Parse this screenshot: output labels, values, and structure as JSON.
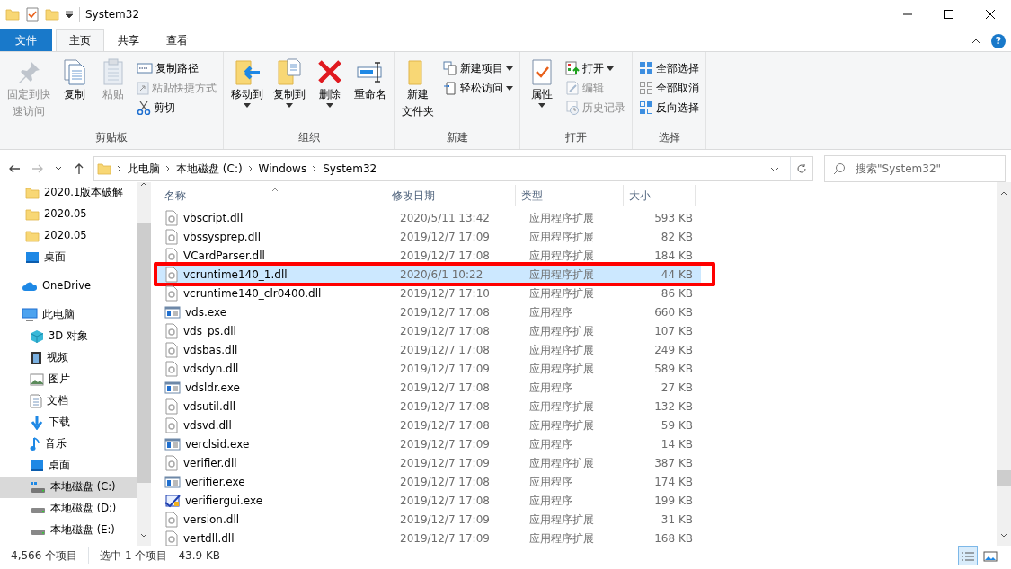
{
  "window": {
    "title": "System32"
  },
  "tabs": [
    {
      "label": "文件",
      "kind": "file",
      "selected": false
    },
    {
      "label": "主页",
      "kind": "tab",
      "selected": true
    },
    {
      "label": "共享",
      "kind": "tab",
      "selected": false
    },
    {
      "label": "查看",
      "kind": "tab",
      "selected": false
    }
  ],
  "help": "?",
  "ribbon": {
    "groups": [
      {
        "label": "剪贴板",
        "items": [
          {
            "label": [
              "固定到快",
              "速访问"
            ],
            "kind": "large",
            "disabled": true,
            "dropdown": false
          },
          {
            "label": [
              "复制"
            ],
            "kind": "large",
            "disabled": false,
            "dropdown": false
          },
          {
            "label": [
              "粘贴"
            ],
            "kind": "large",
            "disabled": true,
            "dropdown": false
          },
          {
            "label": "复制路径",
            "kind": "small",
            "disabled": false,
            "dropdown": false
          },
          {
            "label": "粘贴快捷方式",
            "kind": "small",
            "disabled": true,
            "dropdown": false
          },
          {
            "label": "剪切",
            "kind": "small",
            "disabled": false,
            "dropdown": false
          }
        ]
      },
      {
        "label": "组织",
        "items": [
          {
            "label": [
              "移动到"
            ],
            "kind": "large",
            "disabled": false,
            "dropdown": true
          },
          {
            "label": [
              "复制到"
            ],
            "kind": "large",
            "disabled": false,
            "dropdown": true
          },
          {
            "label": [
              "删除"
            ],
            "kind": "large",
            "disabled": false,
            "dropdown": true
          },
          {
            "label": [
              "重命名"
            ],
            "kind": "large",
            "disabled": false,
            "dropdown": false
          }
        ]
      },
      {
        "label": "新建",
        "items": [
          {
            "label": [
              "新建",
              "文件夹"
            ],
            "kind": "large",
            "disabled": false,
            "dropdown": false
          },
          {
            "label": "新建项目",
            "kind": "small",
            "disabled": false,
            "dropdown": true
          },
          {
            "label": "轻松访问",
            "kind": "small",
            "disabled": false,
            "dropdown": true
          }
        ]
      },
      {
        "label": "打开",
        "items": [
          {
            "label": [
              "属性"
            ],
            "kind": "large",
            "disabled": false,
            "dropdown": true
          },
          {
            "label": "打开",
            "kind": "small",
            "disabled": false,
            "dropdown": true
          },
          {
            "label": "编辑",
            "kind": "small",
            "disabled": true,
            "dropdown": false
          },
          {
            "label": "历史记录",
            "kind": "small",
            "disabled": true,
            "dropdown": false
          }
        ]
      },
      {
        "label": "选择",
        "items": [
          {
            "label": "全部选择",
            "kind": "small",
            "disabled": false,
            "dropdown": false
          },
          {
            "label": "全部取消",
            "kind": "small",
            "disabled": false,
            "dropdown": false
          },
          {
            "label": "反向选择",
            "kind": "small",
            "disabled": false,
            "dropdown": false
          }
        ]
      }
    ]
  },
  "address": {
    "nav_buttons": [
      {
        "disabled": false
      },
      {
        "disabled": true
      },
      {
        "disabled": false
      },
      {
        "disabled": false
      }
    ],
    "path": [
      "此电脑",
      "本地磁盘 (C:)",
      "Windows",
      "System32"
    ],
    "search": {
      "placeholder": "搜索\"System32\""
    }
  },
  "sidebar": {
    "quick_access_items": [
      {
        "label": "2020.1版本破解",
        "selected": false
      },
      {
        "label": "2020.05",
        "selected": false
      },
      {
        "label": "2020.05",
        "selected": false
      },
      {
        "label": "桌面",
        "selected": false
      }
    ],
    "items": [
      {
        "label": "OneDrive",
        "selected": false
      },
      {
        "label": "此电脑",
        "selected": false,
        "children": [
          {
            "label": "3D 对象",
            "selected": false
          },
          {
            "label": "视频",
            "selected": false
          },
          {
            "label": "图片",
            "selected": false
          },
          {
            "label": "文档",
            "selected": false
          },
          {
            "label": "下载",
            "selected": false
          },
          {
            "label": "音乐",
            "selected": false
          },
          {
            "label": "桌面",
            "selected": false
          },
          {
            "label": "本地磁盘 (C:)",
            "selected": true
          },
          {
            "label": "本地磁盘 (D:)",
            "selected": false
          },
          {
            "label": "本地磁盘 (E:)",
            "selected": false
          }
        ]
      }
    ]
  },
  "table": {
    "columns": [
      "名称",
      "修改日期",
      "类型",
      "大小"
    ],
    "rows": [
      {
        "name": "vbscript.dll",
        "date": "2020/5/11 13:42",
        "type": "应用程序扩展",
        "size": "593 KB",
        "selected": false,
        "outlined": false
      },
      {
        "name": "vbssysprep.dll",
        "date": "2019/12/7 17:09",
        "type": "应用程序扩展",
        "size": "82 KB",
        "selected": false,
        "outlined": false
      },
      {
        "name": "VCardParser.dll",
        "date": "2019/12/7 17:08",
        "type": "应用程序扩展",
        "size": "184 KB",
        "selected": false,
        "outlined": false
      },
      {
        "name": "vcruntime140_1.dll",
        "date": "2020/6/1 10:22",
        "type": "应用程序扩展",
        "size": "44 KB",
        "selected": true,
        "outlined": true
      },
      {
        "name": "vcruntime140_clr0400.dll",
        "date": "2019/12/7 17:10",
        "type": "应用程序扩展",
        "size": "86 KB",
        "selected": false,
        "outlined": false
      },
      {
        "name": "vds.exe",
        "date": "2019/12/7 17:08",
        "type": "应用程序",
        "size": "660 KB",
        "selected": false,
        "outlined": false
      },
      {
        "name": "vds_ps.dll",
        "date": "2019/12/7 17:08",
        "type": "应用程序扩展",
        "size": "107 KB",
        "selected": false,
        "outlined": false
      },
      {
        "name": "vdsbas.dll",
        "date": "2019/12/7 17:08",
        "type": "应用程序扩展",
        "size": "249 KB",
        "selected": false,
        "outlined": false
      },
      {
        "name": "vdsdyn.dll",
        "date": "2019/12/7 17:09",
        "type": "应用程序扩展",
        "size": "589 KB",
        "selected": false,
        "outlined": false
      },
      {
        "name": "vdsldr.exe",
        "date": "2019/12/7 17:08",
        "type": "应用程序",
        "size": "27 KB",
        "selected": false,
        "outlined": false
      },
      {
        "name": "vdsutil.dll",
        "date": "2019/12/7 17:08",
        "type": "应用程序扩展",
        "size": "132 KB",
        "selected": false,
        "outlined": false
      },
      {
        "name": "vdsvd.dll",
        "date": "2019/12/7 17:08",
        "type": "应用程序扩展",
        "size": "59 KB",
        "selected": false,
        "outlined": false
      },
      {
        "name": "verclsid.exe",
        "date": "2019/12/7 17:09",
        "type": "应用程序",
        "size": "14 KB",
        "selected": false,
        "outlined": false
      },
      {
        "name": "verifier.dll",
        "date": "2019/12/7 17:09",
        "type": "应用程序扩展",
        "size": "387 KB",
        "selected": false,
        "outlined": false
      },
      {
        "name": "verifier.exe",
        "date": "2019/12/7 17:08",
        "type": "应用程序",
        "size": "174 KB",
        "selected": false,
        "outlined": false
      },
      {
        "name": "verifiergui.exe",
        "date": "2019/12/7 17:08",
        "type": "应用程序",
        "size": "199 KB",
        "selected": false,
        "outlined": false
      },
      {
        "name": "version.dll",
        "date": "2019/12/7 17:09",
        "type": "应用程序扩展",
        "size": "31 KB",
        "selected": false,
        "outlined": false
      },
      {
        "name": "vertdll.dll",
        "date": "2019/12/7 17:09",
        "type": "应用程序扩展",
        "size": "168 KB",
        "selected": false,
        "outlined": false
      }
    ]
  },
  "status_bar": {
    "item_count": "4,566 个项目",
    "selection": "选中 1 个项目",
    "selection_size": "43.9 KB",
    "views": [
      {
        "selected": true
      },
      {
        "selected": false
      }
    ]
  }
}
